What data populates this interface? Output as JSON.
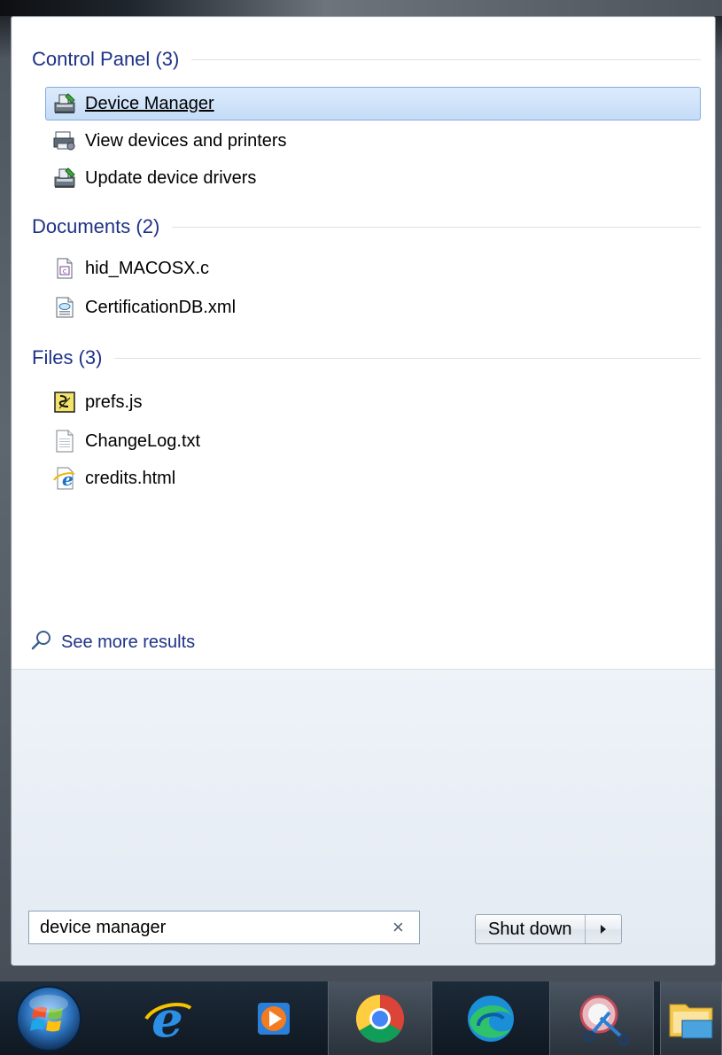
{
  "groups": [
    {
      "title": "Control Panel (3)",
      "items": [
        {
          "label": "Device Manager",
          "icon": "device-manager-icon",
          "selected": true
        },
        {
          "label": "View devices and printers",
          "icon": "printer-icon"
        },
        {
          "label": "Update device drivers",
          "icon": "device-manager-icon"
        }
      ]
    },
    {
      "title": "Documents (2)",
      "items": [
        {
          "label": "hid_MACOSX.c",
          "icon": "c-file-icon"
        },
        {
          "label": "CertificationDB.xml",
          "icon": "xml-file-icon"
        }
      ]
    },
    {
      "title": "Files (3)",
      "items": [
        {
          "label": "prefs.js",
          "icon": "js-file-icon"
        },
        {
          "label": "ChangeLog.txt",
          "icon": "text-file-icon"
        },
        {
          "label": "credits.html",
          "icon": "ie-html-file-icon"
        }
      ]
    }
  ],
  "see_more": {
    "label": "See more results",
    "icon": "search-icon"
  },
  "search": {
    "value": "device manager",
    "clear_icon": "clear-icon"
  },
  "shutdown": {
    "label": "Shut down",
    "arrow_icon": "chevron-right-icon"
  },
  "taskbar": {
    "items": [
      {
        "name": "start-orb",
        "icon": "windows-logo-icon"
      },
      {
        "name": "internet-explorer",
        "icon": "internet-explorer-icon"
      },
      {
        "name": "media-player",
        "icon": "media-player-icon"
      },
      {
        "name": "chrome",
        "icon": "chrome-icon"
      },
      {
        "name": "edge",
        "icon": "edge-icon"
      },
      {
        "name": "snipping-tool",
        "icon": "snipping-tool-icon"
      },
      {
        "name": "file-explorer",
        "icon": "folder-icon"
      }
    ]
  },
  "colors": {
    "group_title": "#1e3287",
    "selected_bg": "#c4dcf7",
    "selected_border": "#84acdd"
  }
}
